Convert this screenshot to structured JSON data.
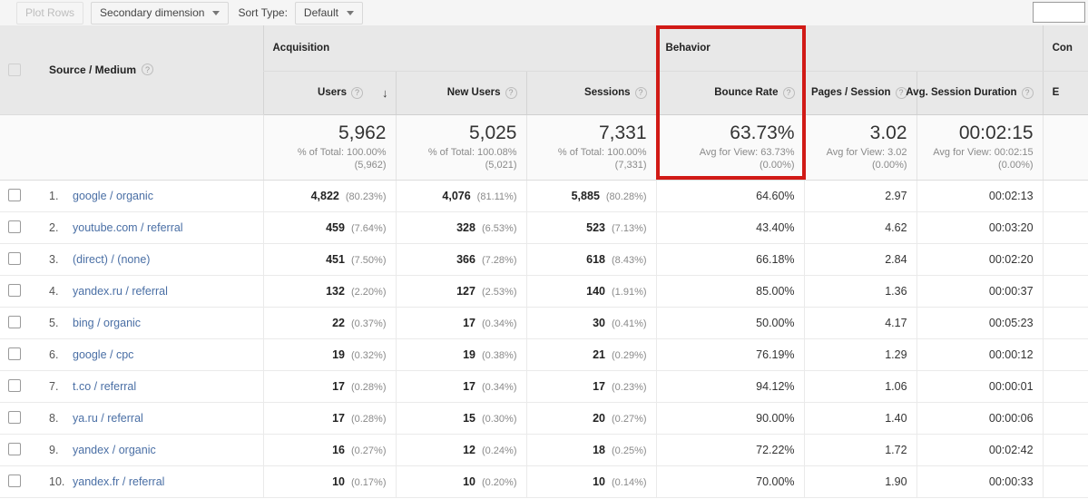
{
  "toolbar": {
    "plot_rows_label": "Plot Rows",
    "secondary_dimension_label": "Secondary dimension",
    "sort_type_label": "Sort Type:",
    "sort_type_value": "Default",
    "search_value": ""
  },
  "groups": {
    "acquisition": "Acquisition",
    "behavior": "Behavior",
    "conversions": "Con"
  },
  "columns": {
    "source_medium": "Source / Medium",
    "users": "Users",
    "new_users": "New Users",
    "sessions": "Sessions",
    "bounce_rate": "Bounce Rate",
    "pages_per_session": "Pages / Session",
    "avg_session_duration": "Avg. Session Duration",
    "ecommerce": "E",
    "help_glyph": "?",
    "sort_arrow_glyph": "↓"
  },
  "summary": {
    "users": {
      "value": "5,962",
      "line1": "% of Total: 100.00%",
      "line2": "(5,962)"
    },
    "new_users": {
      "value": "5,025",
      "line1": "% of Total: 100.08%",
      "line2": "(5,021)"
    },
    "sessions": {
      "value": "7,331",
      "line1": "% of Total: 100.00%",
      "line2": "(7,331)"
    },
    "bounce_rate": {
      "value": "63.73%",
      "line1": "Avg for View: 63.73%",
      "line2": "(0.00%)"
    },
    "pages_per_session": {
      "value": "3.02",
      "line1": "Avg for View: 3.02",
      "line2": "(0.00%)"
    },
    "avg_session_duration": {
      "value": "00:02:15",
      "line1": "Avg for View: 00:02:15",
      "line2": "(0.00%)"
    }
  },
  "rows": [
    {
      "index": "1.",
      "source": "google / organic",
      "users": "4,822",
      "users_pct": "(80.23%)",
      "new_users": "4,076",
      "new_users_pct": "(81.11%)",
      "sessions": "5,885",
      "sessions_pct": "(80.28%)",
      "bounce_rate": "64.60%",
      "pages_per_session": "2.97",
      "avg_session_duration": "00:02:13"
    },
    {
      "index": "2.",
      "source": "youtube.com / referral",
      "users": "459",
      "users_pct": "(7.64%)",
      "new_users": "328",
      "new_users_pct": "(6.53%)",
      "sessions": "523",
      "sessions_pct": "(7.13%)",
      "bounce_rate": "43.40%",
      "pages_per_session": "4.62",
      "avg_session_duration": "00:03:20"
    },
    {
      "index": "3.",
      "source": "(direct) / (none)",
      "users": "451",
      "users_pct": "(7.50%)",
      "new_users": "366",
      "new_users_pct": "(7.28%)",
      "sessions": "618",
      "sessions_pct": "(8.43%)",
      "bounce_rate": "66.18%",
      "pages_per_session": "2.84",
      "avg_session_duration": "00:02:20"
    },
    {
      "index": "4.",
      "source": "yandex.ru / referral",
      "users": "132",
      "users_pct": "(2.20%)",
      "new_users": "127",
      "new_users_pct": "(2.53%)",
      "sessions": "140",
      "sessions_pct": "(1.91%)",
      "bounce_rate": "85.00%",
      "pages_per_session": "1.36",
      "avg_session_duration": "00:00:37"
    },
    {
      "index": "5.",
      "source": "bing / organic",
      "users": "22",
      "users_pct": "(0.37%)",
      "new_users": "17",
      "new_users_pct": "(0.34%)",
      "sessions": "30",
      "sessions_pct": "(0.41%)",
      "bounce_rate": "50.00%",
      "pages_per_session": "4.17",
      "avg_session_duration": "00:05:23"
    },
    {
      "index": "6.",
      "source": "google / cpc",
      "users": "19",
      "users_pct": "(0.32%)",
      "new_users": "19",
      "new_users_pct": "(0.38%)",
      "sessions": "21",
      "sessions_pct": "(0.29%)",
      "bounce_rate": "76.19%",
      "pages_per_session": "1.29",
      "avg_session_duration": "00:00:12"
    },
    {
      "index": "7.",
      "source": "t.co / referral",
      "users": "17",
      "users_pct": "(0.28%)",
      "new_users": "17",
      "new_users_pct": "(0.34%)",
      "sessions": "17",
      "sessions_pct": "(0.23%)",
      "bounce_rate": "94.12%",
      "pages_per_session": "1.06",
      "avg_session_duration": "00:00:01"
    },
    {
      "index": "8.",
      "source": "ya.ru / referral",
      "users": "17",
      "users_pct": "(0.28%)",
      "new_users": "15",
      "new_users_pct": "(0.30%)",
      "sessions": "20",
      "sessions_pct": "(0.27%)",
      "bounce_rate": "90.00%",
      "pages_per_session": "1.40",
      "avg_session_duration": "00:00:06"
    },
    {
      "index": "9.",
      "source": "yandex / organic",
      "users": "16",
      "users_pct": "(0.27%)",
      "new_users": "12",
      "new_users_pct": "(0.24%)",
      "sessions": "18",
      "sessions_pct": "(0.25%)",
      "bounce_rate": "72.22%",
      "pages_per_session": "1.72",
      "avg_session_duration": "00:02:42"
    },
    {
      "index": "10.",
      "source": "yandex.fr / referral",
      "users": "10",
      "users_pct": "(0.17%)",
      "new_users": "10",
      "new_users_pct": "(0.20%)",
      "sessions": "10",
      "sessions_pct": "(0.14%)",
      "bounce_rate": "70.00%",
      "pages_per_session": "1.90",
      "avg_session_duration": "00:00:33"
    }
  ],
  "annotation": {
    "highlight_color": "#d11a16"
  }
}
